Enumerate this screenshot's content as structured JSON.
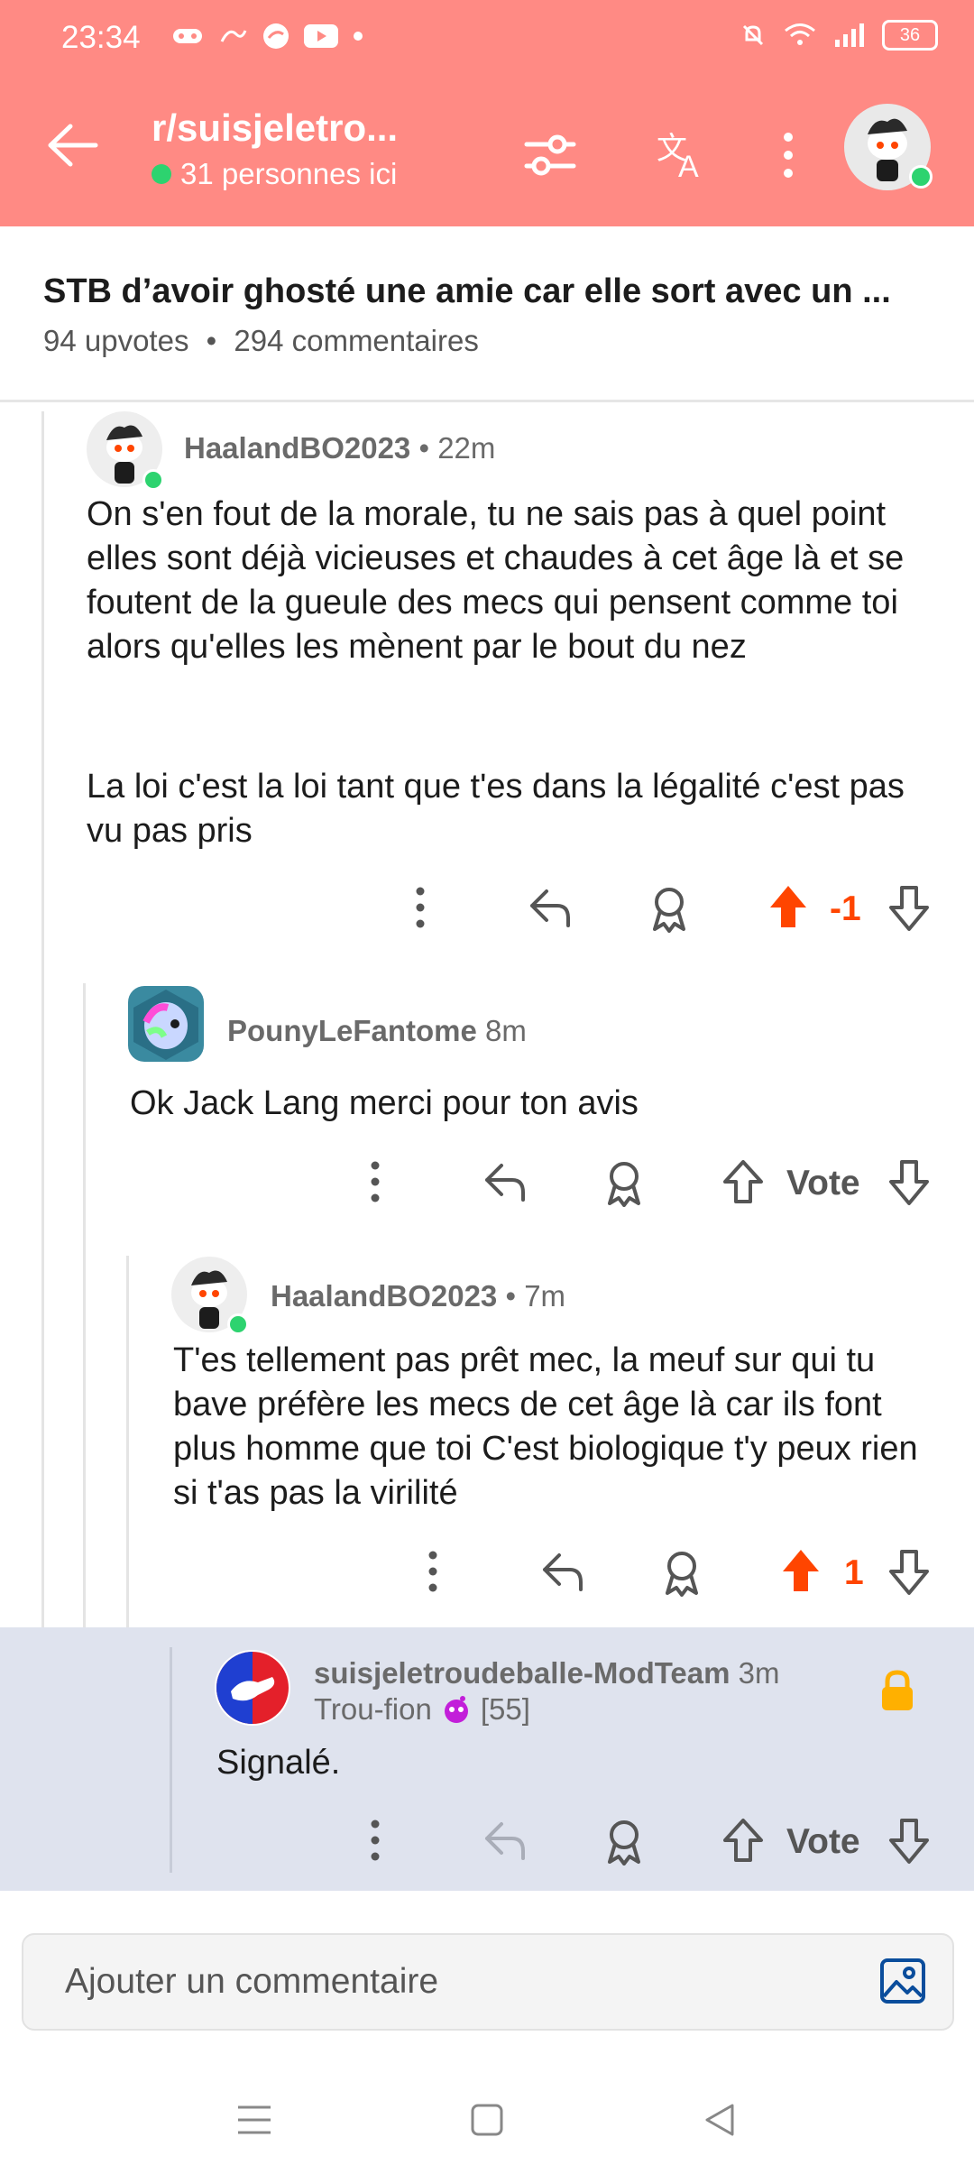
{
  "status": {
    "time": "23:34",
    "battery": "36"
  },
  "header": {
    "subreddit": "r/suisjeletro...",
    "online": "31 personnes ici"
  },
  "post": {
    "title": "STB d’avoir ghosté une amie car elle sort avec un ...",
    "upvotes": "94 upvotes",
    "sep": "•",
    "comments": "294 commentaires"
  },
  "comments": [
    {
      "author": "HaalandBO2023",
      "time": "• 22m",
      "body": "On s'en fout de la morale, tu ne sais pas à quel point elles sont déjà vicieuses et chaudes à cet âge là et se foutent de la gueule des mecs qui pensent comme toi alors qu'elles les mènent par le bout du nez",
      "body2": "La loi c'est la loi tant que t'es dans la légalité c'est pas vu pas pris",
      "score": "-1"
    },
    {
      "author": "PounyLeFantome",
      "time": "8m",
      "body": "Ok Jack Lang merci pour ton avis",
      "score": "Vote"
    },
    {
      "author": "HaalandBO2023",
      "time": "• 7m",
      "body": "T'es tellement pas prêt mec, la meuf sur qui tu bave préfère les mecs de cet âge là car ils font plus homme que toi C'est biologique t'y peux rien si t'as pas la virilité",
      "score": "1"
    },
    {
      "author": "suisjeletroudeballe-ModTeam",
      "time": "3m",
      "flair": "Trou-fion",
      "flair_count": "[55]",
      "body": "Signalé.",
      "score": "Vote"
    }
  ],
  "compose": {
    "placeholder": "Ajouter un commentaire"
  },
  "colors": {
    "header_bg": "#ff8a84",
    "upvote": "#ff4500",
    "mod_bg": "#dfe3ee",
    "lock": "#ffb000",
    "link_blue": "#0a4d9c"
  }
}
